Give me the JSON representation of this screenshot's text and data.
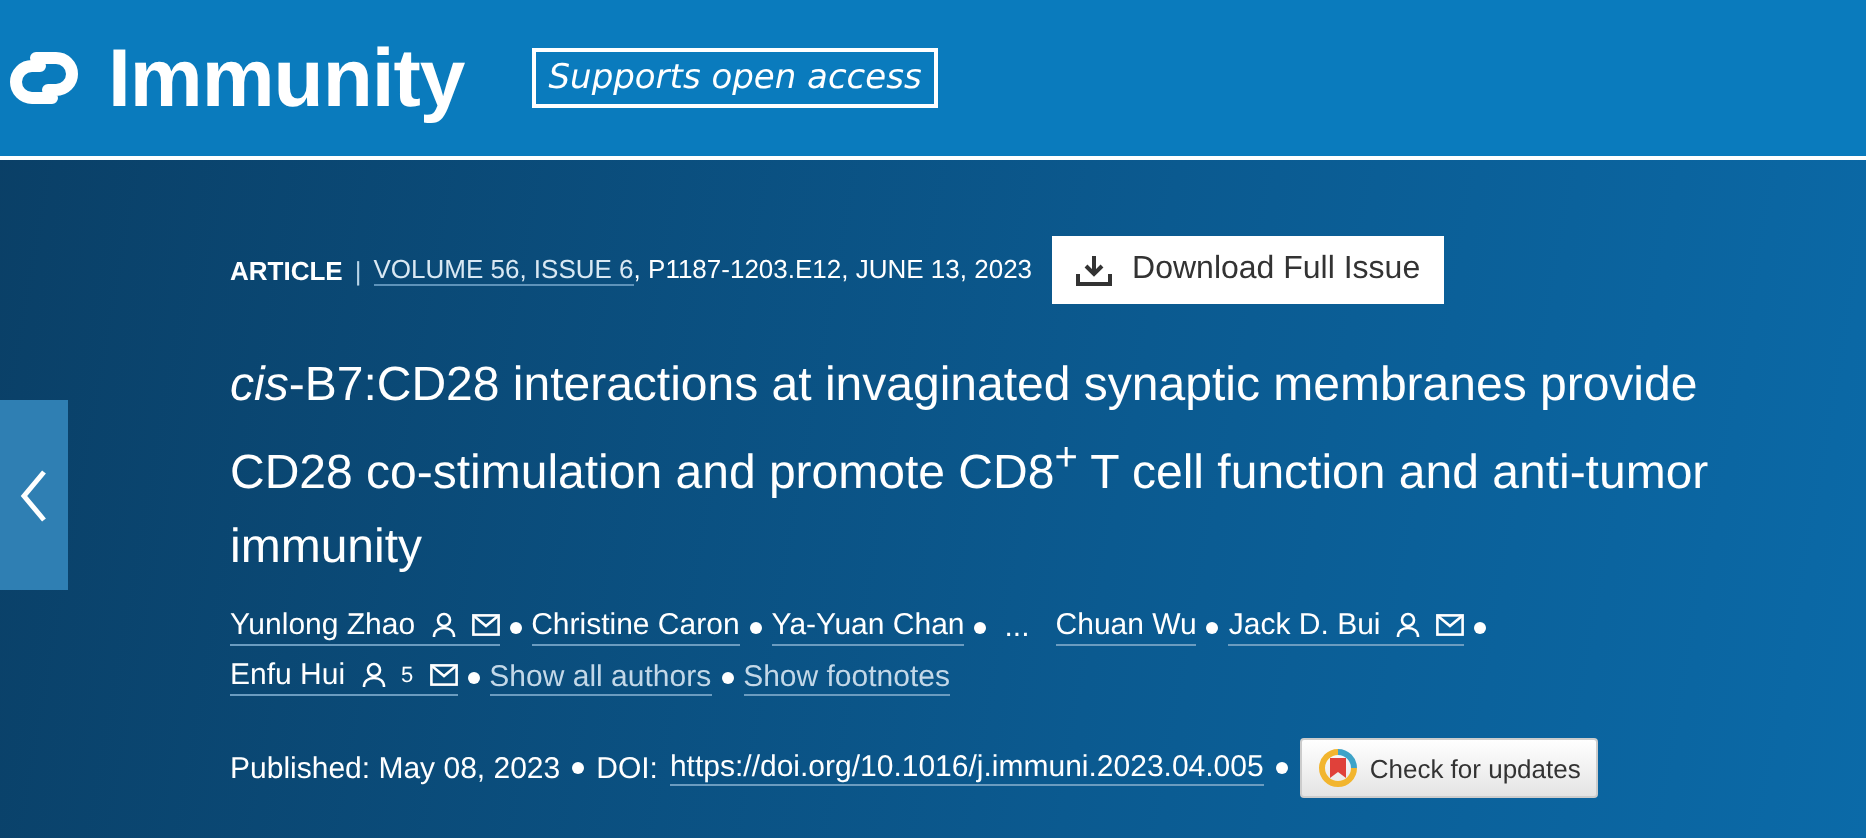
{
  "header": {
    "journal": "Immunity",
    "badge": "Supports open access"
  },
  "meta": {
    "type": "ARTICLE",
    "separator": "|",
    "volume": "VOLUME 56, ISSUE 6",
    "rest": ", P1187-1203.E12, JUNE 13, 2023",
    "download": "Download Full Issue"
  },
  "title": "*cis*-B7:CD28 interactions at invaginated synaptic membranes provide CD28 co-stimulation and promote CD8$^{+}$ T cell function and anti-tumor immunity",
  "authors": [
    {
      "kind": "author",
      "name": "Yunlong Zhao",
      "profile": true,
      "email": true
    },
    {
      "kind": "author",
      "name": "Christine Caron"
    },
    {
      "kind": "author",
      "name": "Ya-Yuan Chan"
    },
    {
      "kind": "ellipsis",
      "name": "..."
    },
    {
      "kind": "author",
      "name": "Chuan Wu"
    },
    {
      "kind": "author",
      "name": "Jack D. Bui",
      "profile": true,
      "email": true
    },
    {
      "kind": "author",
      "name": "Enfu Hui",
      "profile": true,
      "footnote": "5",
      "email": true
    }
  ],
  "author_links": [
    "Show all authors",
    "Show footnotes"
  ],
  "published": "Published: May 08, 2023",
  "doi_label": "DOI:",
  "doi": "https://doi.org/10.1016/j.immuni.2023.04.005",
  "updates": "Check for updates"
}
